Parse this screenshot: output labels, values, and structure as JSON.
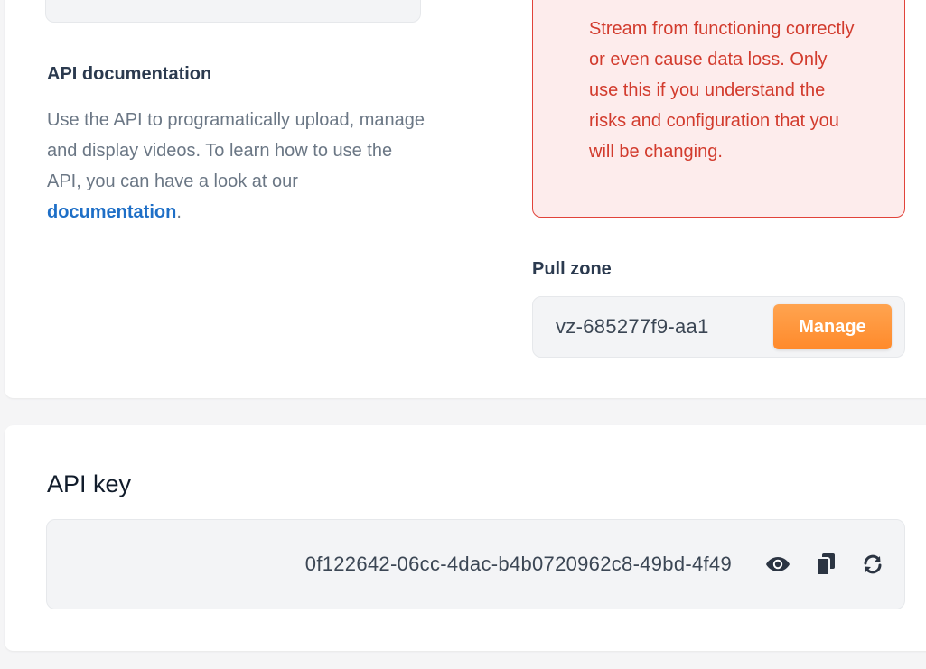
{
  "api_documentation": {
    "title": "API documentation",
    "description_prefix": "Use the API to programatically upload, manage and display videos. To learn how to use the API, you can have a look at our ",
    "link_text": "documentation",
    "description_suffix": "."
  },
  "warning": {
    "text": "Stream from functioning correctly or even cause data loss. Only use this if you understand the risks and configuration that you will be changing."
  },
  "pull_zone": {
    "label": "Pull zone",
    "value": "vz-685277f9-aa1",
    "manage_label": "Manage"
  },
  "api_key": {
    "title": "API key",
    "value": "0f122642-06cc-4dac-b4b0720962c8-49bd-4f49",
    "icons": [
      "eye-icon",
      "copy-icon",
      "refresh-icon"
    ]
  },
  "colors": {
    "accent": "#ff8a2b",
    "link": "#1e6fc7",
    "warning": "#d23b2d",
    "warning_bg": "#fdecec"
  }
}
